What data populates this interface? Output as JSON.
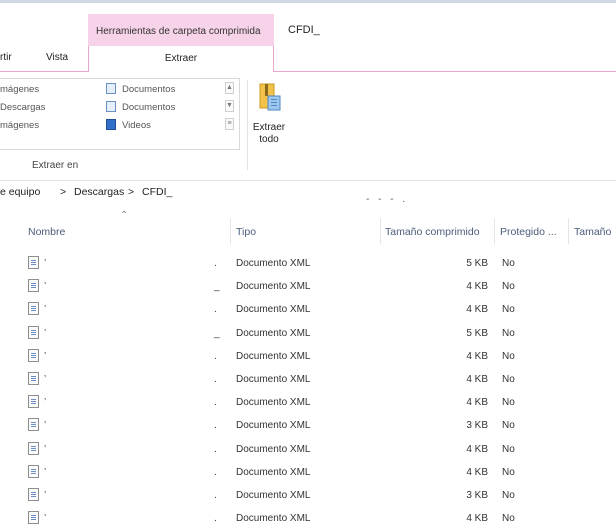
{
  "window": {
    "context_tab": "Herramientas de carpeta comprimida",
    "title": "CFDI_"
  },
  "ribbon": {
    "tabs": [
      "rtir",
      "Vista"
    ],
    "active_tab": "Extraer",
    "destinations_left": [
      "mágenes",
      "Descargas",
      "mágenes"
    ],
    "destinations_right": [
      "Documentos",
      "Documentos",
      "Videos"
    ],
    "group_label": "Extraer en",
    "extract_all_label": "Extraer todo"
  },
  "address": {
    "crumbs": [
      "e equipo",
      "Descargas",
      "CFDI_"
    ],
    "separator": ">",
    "trailing": "- - - ."
  },
  "columns": {
    "name": "Nombre",
    "type": "Tipo",
    "compressed_size": "Tamaño comprimido",
    "protected": "Protegido ...",
    "size": "Tamaño"
  },
  "files": [
    {
      "mark": ".",
      "type": "Documento XML",
      "compressed": "5 KB",
      "protected": "No"
    },
    {
      "mark": "_",
      "type": "Documento XML",
      "compressed": "4 KB",
      "protected": "No"
    },
    {
      "mark": ".",
      "type": "Documento XML",
      "compressed": "4 KB",
      "protected": "No"
    },
    {
      "mark": "_",
      "type": "Documento XML",
      "compressed": "5 KB",
      "protected": "No"
    },
    {
      "mark": ".",
      "type": "Documento XML",
      "compressed": "4 KB",
      "protected": "No"
    },
    {
      "mark": ".",
      "type": "Documento XML",
      "compressed": "4 KB",
      "protected": "No"
    },
    {
      "mark": ".",
      "type": "Documento XML",
      "compressed": "4 KB",
      "protected": "No"
    },
    {
      "mark": ".",
      "type": "Documento XML",
      "compressed": "3 KB",
      "protected": "No"
    },
    {
      "mark": ".",
      "type": "Documento XML",
      "compressed": "4 KB",
      "protected": "No"
    },
    {
      "mark": ".",
      "type": "Documento XML",
      "compressed": "4 KB",
      "protected": "No"
    },
    {
      "mark": ".",
      "type": "Documento XML",
      "compressed": "3 KB",
      "protected": "No"
    },
    {
      "mark": ".",
      "type": "Documento XML",
      "compressed": "4 KB",
      "protected": "No"
    }
  ],
  "colors": {
    "tool_tab": "#f6d3e8",
    "accent_border": "#e8a6cf",
    "header_text": "#4a5d7a"
  }
}
